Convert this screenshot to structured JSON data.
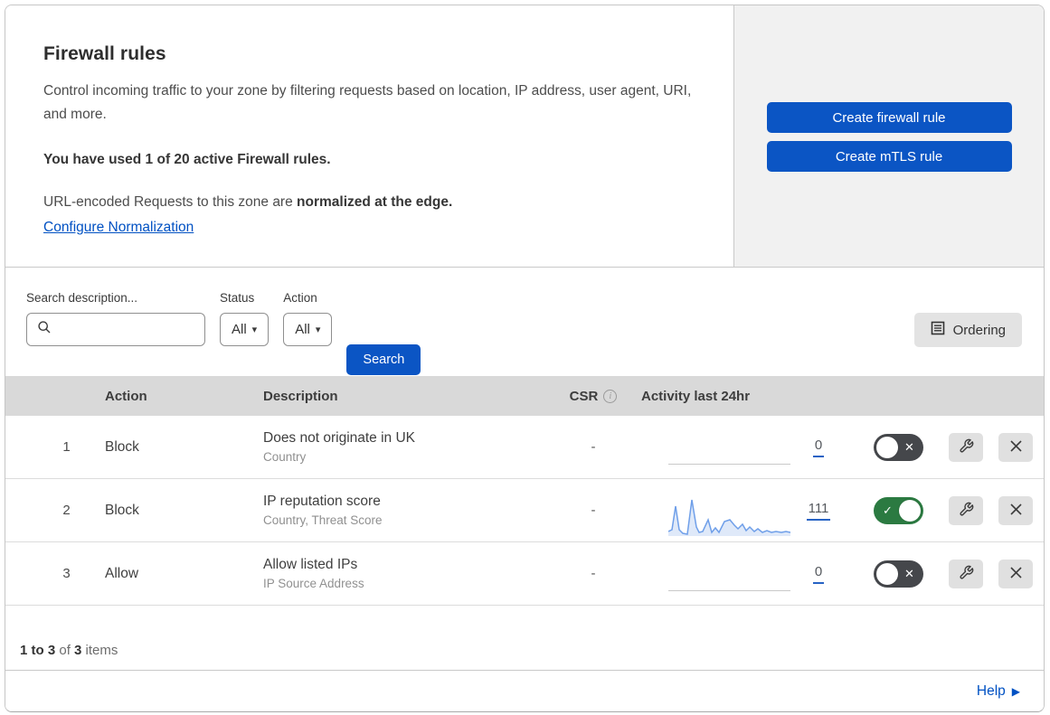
{
  "header": {
    "title": "Firewall rules",
    "description": "Control incoming traffic to your zone by filtering requests based on location, IP address, user agent, URI, and more.",
    "usage_line": "You have used 1 of 20 active Firewall rules.",
    "normalization_prefix": "URL-encoded Requests to this zone are ",
    "normalization_bold": "normalized at the edge.",
    "normalization_link": "Configure Normalization",
    "create_firewall_button": "Create firewall rule",
    "create_mtls_button": "Create mTLS rule"
  },
  "filters": {
    "search_label": "Search description...",
    "search_value": "",
    "status_label": "Status",
    "status_value": "All",
    "action_label": "Action",
    "action_value": "All",
    "search_button": "Search",
    "ordering_button": "Ordering"
  },
  "table": {
    "columns": {
      "action": "Action",
      "description": "Description",
      "csr": "CSR",
      "activity": "Activity last 24hr"
    },
    "rows": [
      {
        "index": "1",
        "action": "Block",
        "description": "Does not originate in UK",
        "fields": "Country",
        "csr": "-",
        "activity_count": "0",
        "enabled": false,
        "has_sparkline": false
      },
      {
        "index": "2",
        "action": "Block",
        "description": "IP reputation score",
        "fields": "Country, Threat Score",
        "csr": "-",
        "activity_count": "111",
        "enabled": true,
        "has_sparkline": true
      },
      {
        "index": "3",
        "action": "Allow",
        "description": "Allow listed IPs",
        "fields": "IP Source Address",
        "csr": "-",
        "activity_count": "0",
        "enabled": false,
        "has_sparkline": false
      }
    ]
  },
  "footer": {
    "range_bold": "1 to 3",
    "of_text": " of ",
    "total_bold": "3",
    "items_text": " items",
    "help_label": "Help"
  },
  "chart_data": {
    "type": "area",
    "title": "Activity last 24hr sparkline (rule 2)",
    "x": "time over last 24hr (unlabeled)",
    "values_normalized_0to1": [
      0.1,
      0.15,
      0.72,
      0.15,
      0.05,
      0.02,
      0.87,
      0.22,
      0.08,
      0.1,
      0.39,
      0.08,
      0.2,
      0.08,
      0.35,
      0.39,
      0.26,
      0.17,
      0.28,
      0.13,
      0.22,
      0.1,
      0.17,
      0.08,
      0.13,
      0.08,
      0.1,
      0.08,
      0.1,
      0.08
    ],
    "total": 111,
    "line_color": "#6f9fe9",
    "fill_color": "#dfe9f9"
  },
  "colors": {
    "primary_blue": "#0b55c4",
    "link_blue": "#0051c3",
    "toggle_on_green": "#2b7a41",
    "toggle_off_gray": "#45474b",
    "table_header_bg": "#d9d9d9",
    "side_panel_bg": "#f1f1f1",
    "sparkline_blue": "#6f9fe9"
  }
}
